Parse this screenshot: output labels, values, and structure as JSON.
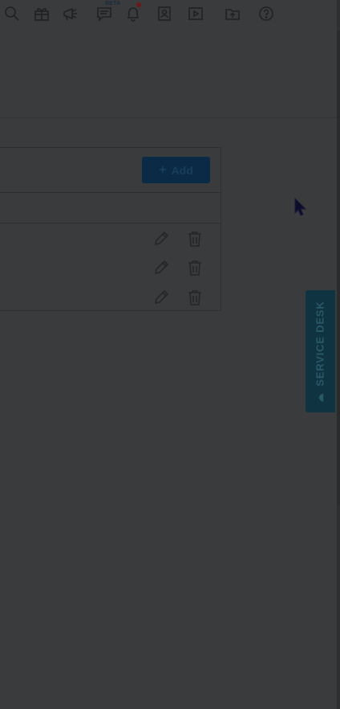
{
  "topbar": {
    "beta_badge": "BETA",
    "icons": [
      "search-icon",
      "gift-icon",
      "megaphone-icon",
      "chat-icon",
      "bell-icon",
      "contact-book-icon",
      "play-icon",
      "upload-folder-icon",
      "help-icon"
    ],
    "has_notification": true
  },
  "panel": {
    "add_label": "Add",
    "rows": [
      {
        "actions": [
          "edit-icon",
          "delete-icon"
        ]
      },
      {
        "actions": [
          "edit-icon",
          "delete-icon"
        ]
      },
      {
        "actions": [
          "edit-icon",
          "delete-icon"
        ]
      }
    ]
  },
  "service_desk": {
    "label": "SERVICE DESK"
  },
  "colors": {
    "overlay": "#3a3b3d",
    "primary": "#0a2a45",
    "service_desk": "#0f3340",
    "notification": "#6a1a1a"
  }
}
